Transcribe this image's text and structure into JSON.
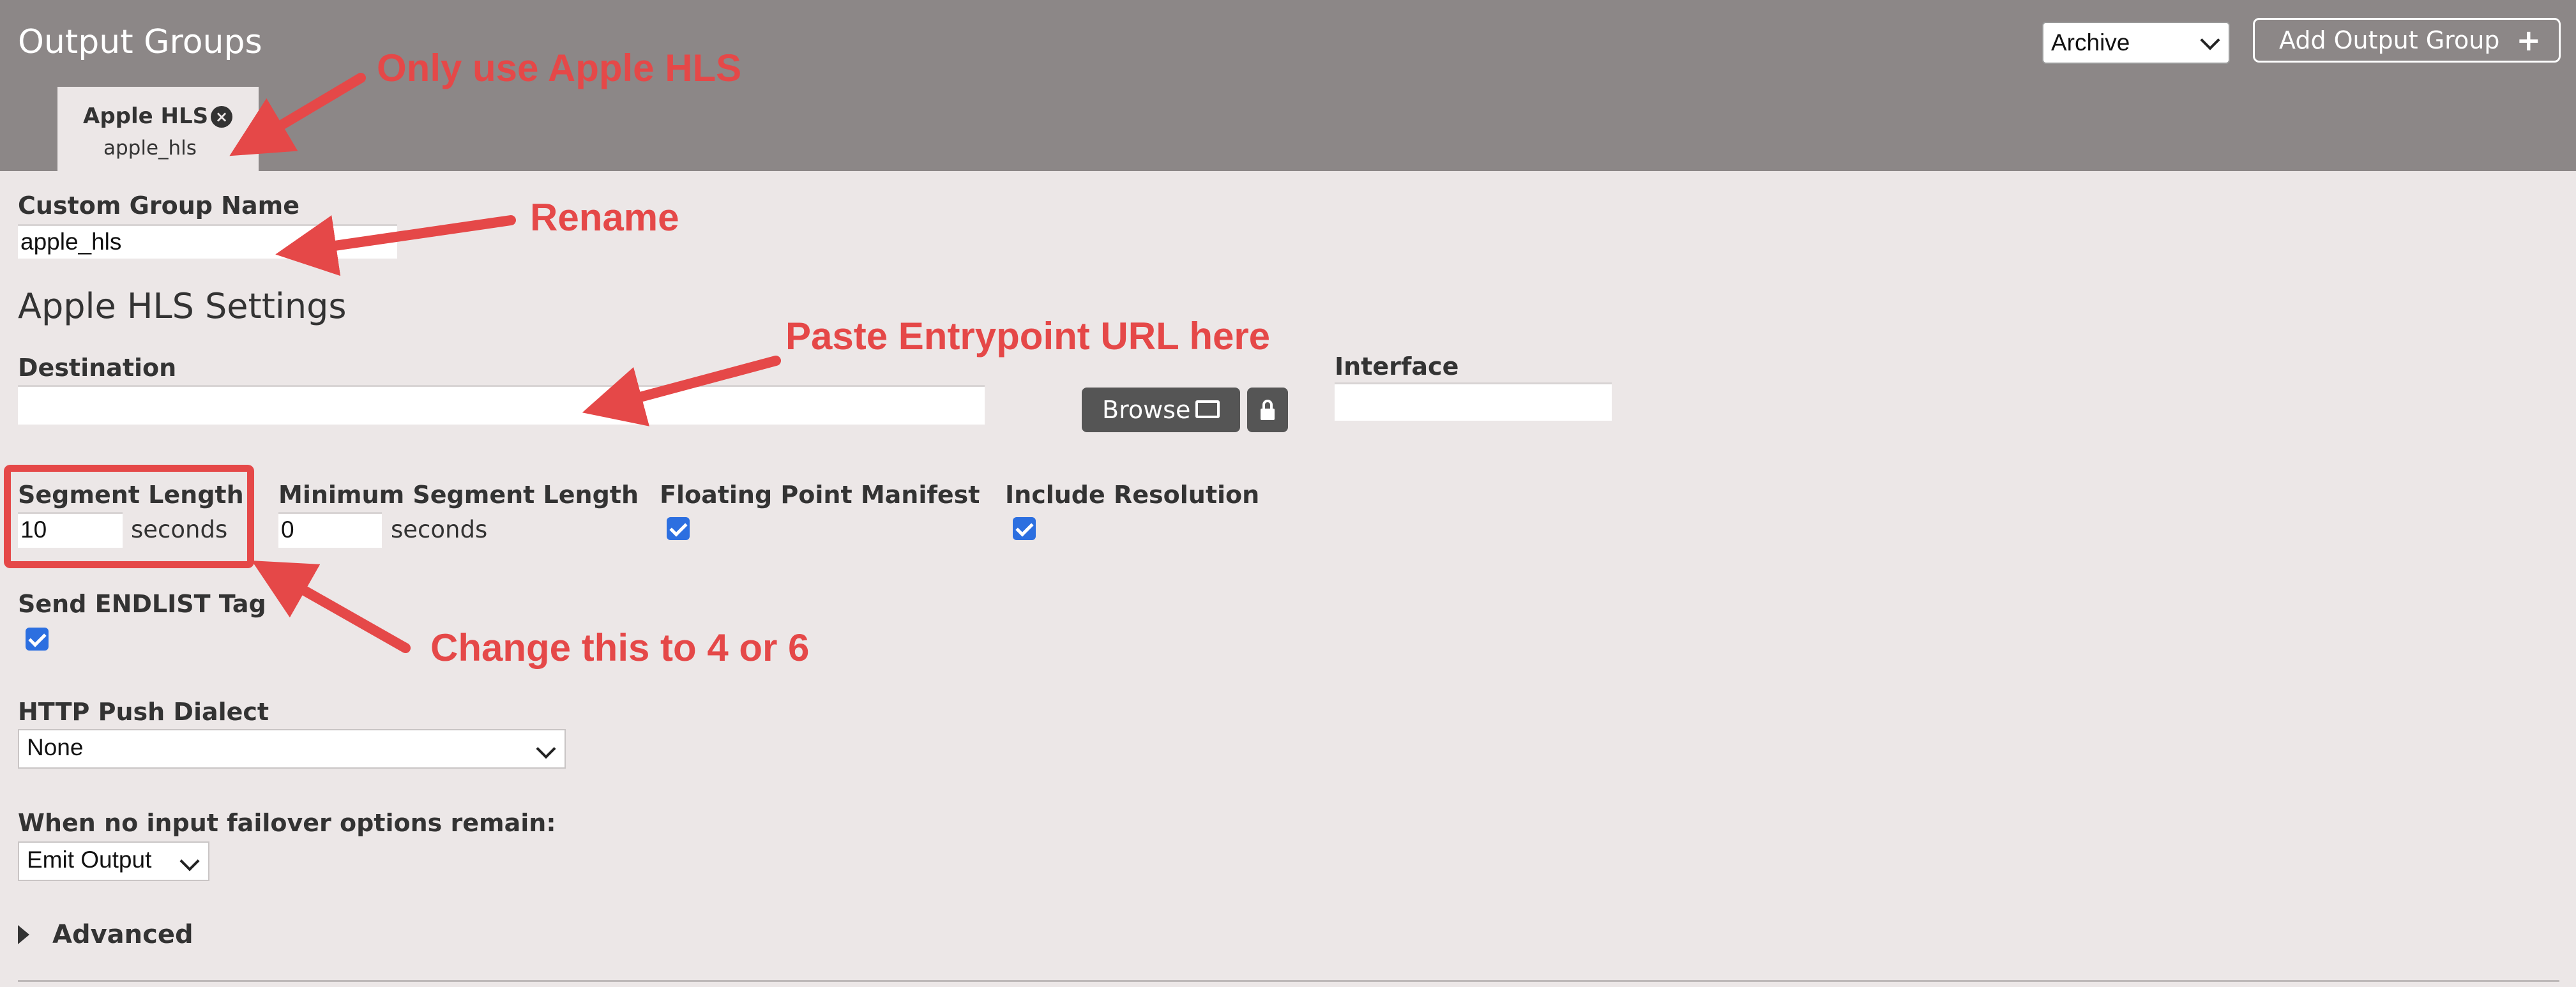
{
  "header": {
    "title": "Output Groups",
    "archive_select": "Archive",
    "add_output_group": "Add Output Group"
  },
  "tab": {
    "title": "Apple HLS",
    "subtitle": "apple_hls"
  },
  "form": {
    "custom_group_name_label": "Custom Group Name",
    "custom_group_name_value": "apple_hls",
    "settings_title": "Apple HLS Settings",
    "destination_label": "Destination",
    "destination_value": "",
    "browse_label": "Browse",
    "interface_label": "Interface",
    "interface_value": "",
    "segment_length_label": "Segment Length",
    "segment_length_value": "10",
    "segment_length_unit": "seconds",
    "min_segment_length_label": "Minimum Segment Length",
    "min_segment_length_value": "0",
    "min_segment_length_unit": "seconds",
    "floating_point_manifest_label": "Floating Point Manifest",
    "floating_point_manifest_checked": true,
    "include_resolution_label": "Include Resolution",
    "include_resolution_checked": true,
    "send_endlist_label": "Send ENDLIST Tag",
    "send_endlist_checked": true,
    "http_push_dialect_label": "HTTP Push Dialect",
    "http_push_dialect_value": "None",
    "failover_label": "When no input failover options remain:",
    "failover_value": "Emit Output",
    "advanced_label": "Advanced"
  },
  "annotations": {
    "only_use": "Only use Apple HLS",
    "rename": "Rename",
    "paste": "Paste Entrypoint URL here",
    "change": "Change this to 4 or 6",
    "color": "#e54848"
  }
}
